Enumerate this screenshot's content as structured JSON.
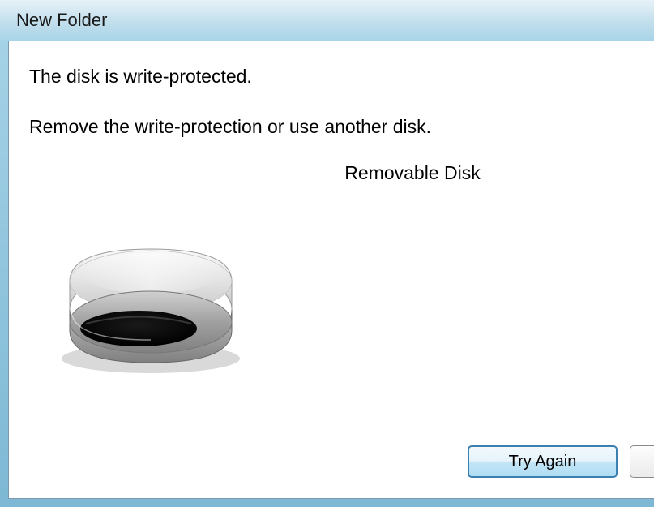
{
  "dialog": {
    "title": "New Folder",
    "message_primary": "The disk is write-protected.",
    "message_secondary": "Remove the write-protection or use another disk.",
    "disk_label": "Removable Disk",
    "buttons": {
      "try_again": "Try Again"
    }
  }
}
